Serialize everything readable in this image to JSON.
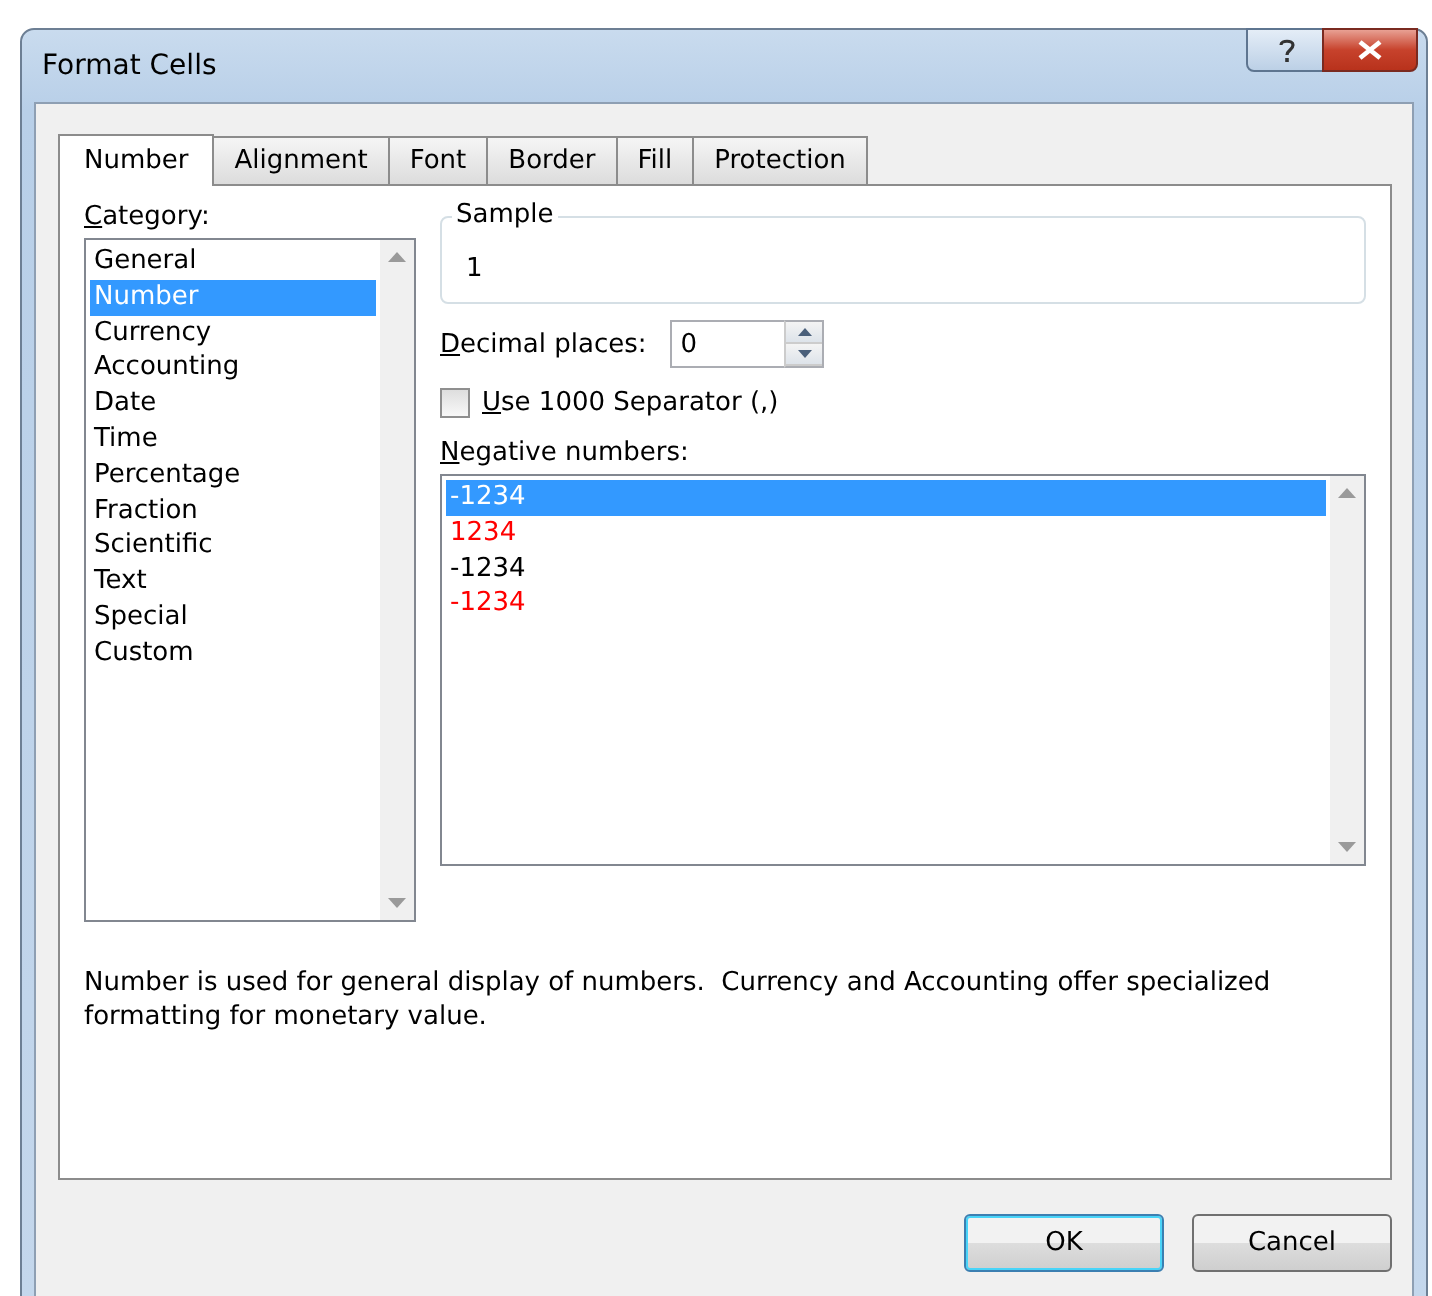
{
  "window": {
    "title": "Format Cells"
  },
  "tabs": [
    {
      "label": "Number",
      "selected": true
    },
    {
      "label": "Alignment",
      "selected": false
    },
    {
      "label": "Font",
      "selected": false
    },
    {
      "label": "Border",
      "selected": false
    },
    {
      "label": "Fill",
      "selected": false
    },
    {
      "label": "Protection",
      "selected": false
    }
  ],
  "category": {
    "label": "Category:",
    "items": [
      {
        "label": "General",
        "selected": false
      },
      {
        "label": "Number",
        "selected": true
      },
      {
        "label": "Currency",
        "selected": false
      },
      {
        "label": "Accounting",
        "selected": false
      },
      {
        "label": "Date",
        "selected": false
      },
      {
        "label": "Time",
        "selected": false
      },
      {
        "label": "Percentage",
        "selected": false
      },
      {
        "label": "Fraction",
        "selected": false
      },
      {
        "label": "Scientific",
        "selected": false
      },
      {
        "label": "Text",
        "selected": false
      },
      {
        "label": "Special",
        "selected": false
      },
      {
        "label": "Custom",
        "selected": false
      }
    ]
  },
  "sample": {
    "label": "Sample",
    "value": "1"
  },
  "decimal_places": {
    "label": "Decimal places:",
    "value": "0"
  },
  "separator": {
    "label": "Use 1000 Separator (,)",
    "checked": false
  },
  "negative_numbers": {
    "label": "Negative numbers:",
    "items": [
      {
        "label": "-1234",
        "selected": true,
        "red": false
      },
      {
        "label": "1234",
        "selected": false,
        "red": true
      },
      {
        "label": "-1234",
        "selected": false,
        "red": false
      },
      {
        "label": "-1234",
        "selected": false,
        "red": true
      }
    ]
  },
  "description": "Number is used for general display of numbers.  Currency and Accounting offer specialized formatting for monetary value.",
  "buttons": [
    "OK",
    "Cancel"
  ]
}
